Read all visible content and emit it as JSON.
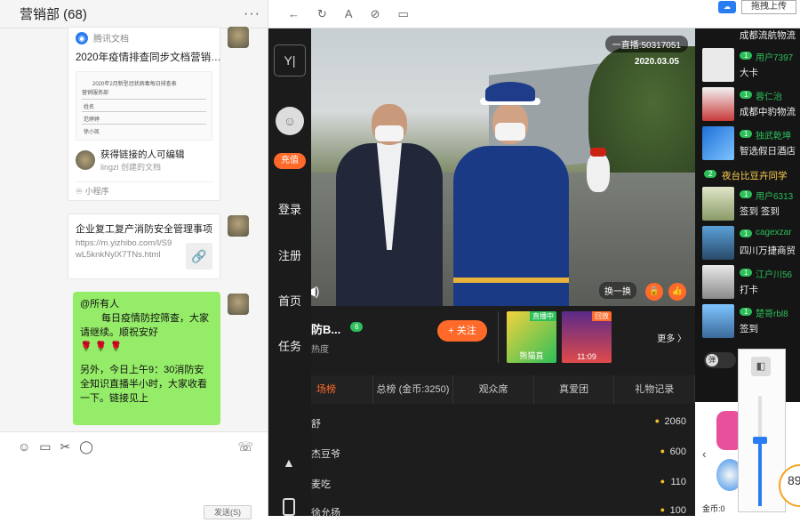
{
  "chat": {
    "title": "营销部 (68)",
    "more": "···",
    "doc_card": {
      "source": "腾讯文档",
      "title": "2020年疫情排查同步文档营销…",
      "thumb_heading": "2020年2月新型冠状病毒每日排查表",
      "thumb_sub": "营销服务部",
      "thumb_names": [
        "姓名",
        "范婷婷",
        "徐小凯"
      ],
      "perm_title": "获得链接的人可编辑",
      "perm_sub": "lingzi 创建的文档",
      "mini_app": "小程序"
    },
    "link_card": {
      "title": "企业复工复产消防安全管理事项",
      "url": "https://m.yizhibo.com/l/S9wL5knkNylX7TNs.html"
    },
    "bubble": {
      "line1": "@所有人",
      "line2": "每日疫情防控筛查，大家请继续。顺祝安好",
      "line3": "另外，今日上午9：30消防安全知识直播半小时，大家收看一下。链接见上"
    },
    "toolbar": {
      "send": "发送(S)"
    }
  },
  "browser": {
    "upload": "拖拽上传",
    "rail": {
      "logo": "Y|",
      "recharge": "充值",
      "login": "登录",
      "register": "注册",
      "home": "首页",
      "task": "任务"
    },
    "video": {
      "live_id": "一直播:50317051",
      "date": "2020.03.05",
      "switch": "换一换"
    },
    "room": {
      "name": "防B...",
      "level": "6",
      "heat": "热度",
      "follow": "+ 关注",
      "more": "更多 〉",
      "rec1_tag": "直播中",
      "rec1_cap": "熊猫直",
      "rec2_tag": "回放",
      "rec2_cap": "11:09"
    },
    "tabs": [
      "场榜",
      "总榜 (金币:3250)",
      "观众席",
      "真爱团",
      "礼物记录"
    ],
    "ranks": [
      {
        "name": "舒",
        "value": "2060"
      },
      {
        "name": "杰豆爷",
        "value": "600"
      },
      {
        "name": "麦吃",
        "value": "110"
      },
      {
        "name": "徐允扬",
        "value": "100"
      }
    ],
    "messages": [
      {
        "lvl": "",
        "user": "",
        "text": "成都流航物流"
      },
      {
        "lvl": "1",
        "user": "用户7397",
        "text": "大卡"
      },
      {
        "lvl": "1",
        "user": "蓉仁治",
        "text": "成都中豹物流"
      },
      {
        "lvl": "1",
        "user": "独武乾坤",
        "text": "智选假日酒店"
      },
      {
        "lvl": "1",
        "user": "用户6313",
        "text": "签到 签到"
      },
      {
        "lvl": "1",
        "user": "cagexzar",
        "text": "四川万捷商贸"
      },
      {
        "lvl": "1",
        "user": "江户川56",
        "text": "打卡"
      },
      {
        "lvl": "1",
        "user": "楚哥rbl8",
        "text": "签到"
      }
    ],
    "sys_message": {
      "lvl": "2",
      "text": "夜台比豆卉同学"
    },
    "danmu": "弹",
    "gift_bottom": "金币:0",
    "side_num": "89"
  },
  "volume": {
    "level": 0.6
  },
  "colors": {
    "accent": "#ff6a2a",
    "level": "#2dbf5a",
    "bubble": "#95ec69"
  }
}
